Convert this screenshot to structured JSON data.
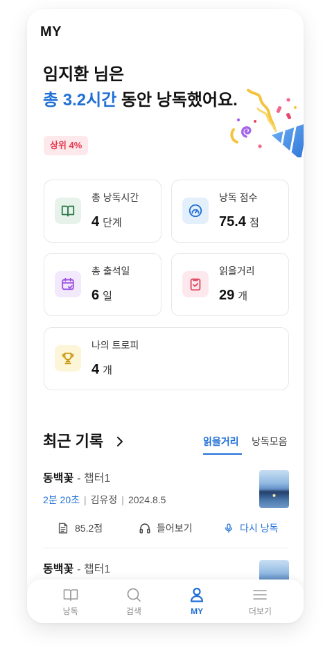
{
  "header": {
    "title": "MY"
  },
  "greeting": {
    "name_line": "임지환 님은",
    "highlight": "총 3.2시간",
    "rest": " 동안 낭독했어요."
  },
  "decoration": "party-popper",
  "badge": {
    "label": "상위 4%"
  },
  "stats": [
    {
      "label": "총 낭독시간",
      "value": "4",
      "unit": "단계",
      "icon": "book-icon",
      "color": "#2f7a4c",
      "bg": "#e7f3ea"
    },
    {
      "label": "낭독 점수",
      "value": "75.4",
      "unit": "점",
      "icon": "gauge-icon",
      "color": "#1f6fd6",
      "bg": "#e4effc"
    },
    {
      "label": "총 출석일",
      "value": "6",
      "unit": "일",
      "icon": "calendar-check-icon",
      "color": "#9a4fe0",
      "bg": "#f3e9fd"
    },
    {
      "label": "읽을거리",
      "value": "29",
      "unit": "개",
      "icon": "clipboard-check-icon",
      "color": "#e0465c",
      "bg": "#fde9ed"
    },
    {
      "label": "나의 트로피",
      "value": "4",
      "unit": "개",
      "icon": "trophy-icon",
      "color": "#c99a12",
      "bg": "#fdf5d8"
    }
  ],
  "recent": {
    "title": "최근 기록",
    "chevron_icon": "chevron-right-icon",
    "tabs": [
      {
        "label": "읽을거리",
        "active": true
      },
      {
        "label": "낭독모음",
        "active": false
      }
    ],
    "separator": "|",
    "records": [
      {
        "title": "동백꽃",
        "chapter": "- 챕터1",
        "duration": "2분 20초",
        "author": "김유정",
        "date": "2024.8.5",
        "score": "85.2점",
        "score_icon": "document-icon",
        "listen_label": "들어보기",
        "listen_icon": "headphones-icon",
        "reread_label": "다시 낭독",
        "reread_icon": "mic-icon"
      },
      {
        "title": "동백꽃",
        "chapter": "- 챕터1"
      }
    ]
  },
  "nav": {
    "items": [
      {
        "label": "낭독",
        "icon": "book-icon",
        "active": false
      },
      {
        "label": "검색",
        "icon": "search-icon",
        "active": false
      },
      {
        "label": "MY",
        "icon": "person-icon",
        "active": true
      },
      {
        "label": "더보기",
        "icon": "menu-icon",
        "active": false
      }
    ]
  },
  "colors": {
    "accent": "#1f6fd6",
    "text": "#111111",
    "muted": "#8a8a8a",
    "badge-bg": "#fde9eb",
    "badge-text": "#e5394f"
  }
}
